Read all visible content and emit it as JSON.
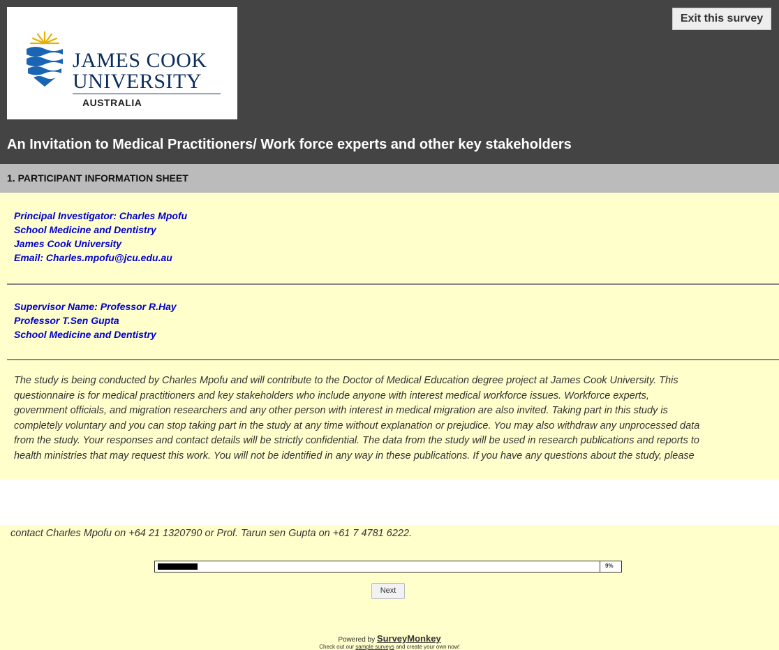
{
  "header": {
    "logo": {
      "line1": "JAMES COOK",
      "line2": "UNIVERSITY",
      "line3": "AUSTRALIA",
      "icon": "jcu-logo-icon"
    },
    "exit_label": "Exit this survey",
    "survey_title": "An Invitation to Medical Practitioners/ Work force experts and other key stakeholders"
  },
  "page_header": {
    "title": "1. PARTICIPANT INFORMATION SHEET"
  },
  "investigator": [
    "Principal Investigator: Charles Mpofu",
    "School Medicine and Dentistry",
    "James Cook University",
    "Email: Charles.mpofu@jcu.edu.au"
  ],
  "supervisor": [
    "Supervisor Name: Professor R.Hay",
    "Professor T.Sen Gupta",
    "School Medicine and Dentistry"
  ],
  "paragraph": [
    "The study is being conducted by Charles Mpofu and will contribute to the Doctor of Medical Education degree project at James Cook University. This",
    "questionnaire is for medical practitioners and key stakeholders who include anyone with interest medical workforce issues. Workforce experts,",
    "government officials, and migration researchers and any other person with interest in medical migration are also invited. Taking part in this study is",
    "completely voluntary and you can stop taking part in the study at any time without explanation or prejudice. You may also withdraw any unprocessed data",
    "from the study. Your responses and contact details will be strictly confidential. The data from the study will be used in research publications and reports to",
    "health ministries that may request this work. You will not be identified in any way in these publications. If you have any questions about the study, please"
  ],
  "contact_line": "contact Charles Mpofu on +64 21 1320790 or Prof. Tarun sen Gupta on +61 7 4781 6222.",
  "progress": {
    "percent": 9,
    "label": "9%"
  },
  "next_label": "Next",
  "footer": {
    "powered_prefix": "Powered by ",
    "brand": "SurveyMonkey",
    "checkout_prefix": "Check out our ",
    "checkout_link": "sample surveys",
    "checkout_suffix": " and create your own now!"
  },
  "colors": {
    "header_bg": "#444444",
    "content_bg": "#ffffcc",
    "section_bg": "#bbbbbb",
    "blue_text": "#0000cc"
  }
}
